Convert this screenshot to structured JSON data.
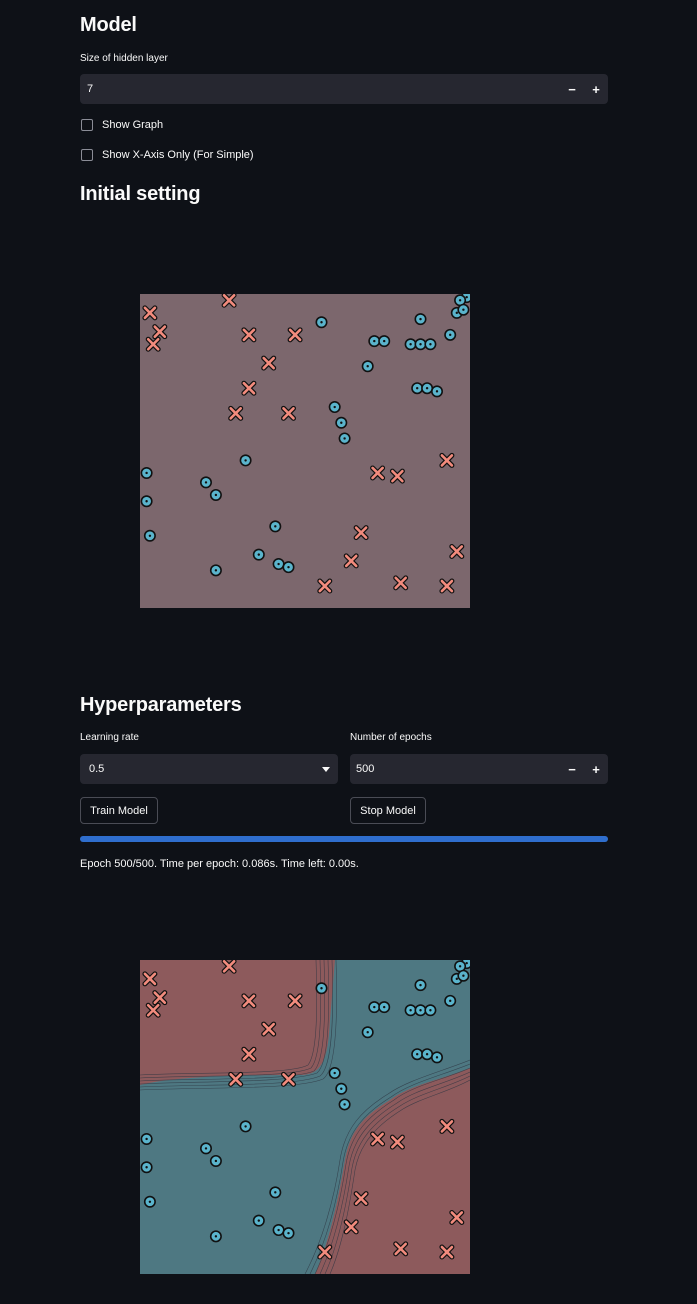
{
  "model": {
    "heading": "Model",
    "hidden_label": "Size of hidden layer",
    "hidden_value": "7",
    "minus": "−",
    "plus": "+",
    "show_graph": "Show Graph",
    "show_x_axis": "Show X-Axis Only (For Simple)"
  },
  "initial": {
    "heading": "Initial setting"
  },
  "hyper": {
    "heading": "Hyperparameters",
    "lr_label": "Learning rate",
    "lr_value": "0.5",
    "epochs_label": "Number of epochs",
    "epochs_value": "500",
    "train_button": "Train Model",
    "stop_button": "Stop Model",
    "progress": 1.0,
    "status": "Epoch 500/500. Time per epoch: 0.086s. Time left: 0.00s."
  },
  "colors": {
    "class_x": "#f28b7d",
    "class_o": "#5ab4cc",
    "region_x": "#8d5a5c",
    "region_o": "#4e7882",
    "initial_bg": "#7c676d"
  },
  "chart_data": [
    {
      "type": "scatter",
      "xlim": [
        0,
        1
      ],
      "ylim": [
        0,
        1
      ],
      "series": [
        {
          "marker": "x",
          "points": [
            [
              0.03,
              0.94
            ],
            [
              0.06,
              0.88
            ],
            [
              0.04,
              0.84
            ],
            [
              0.27,
              0.98
            ],
            [
              0.33,
              0.87
            ],
            [
              0.47,
              0.87
            ],
            [
              0.39,
              0.78
            ],
            [
              0.33,
              0.7
            ],
            [
              0.29,
              0.62
            ],
            [
              0.45,
              0.62
            ],
            [
              0.78,
              0.42
            ],
            [
              0.72,
              0.43
            ],
            [
              0.93,
              0.47
            ],
            [
              0.67,
              0.24
            ],
            [
              0.96,
              0.18
            ],
            [
              0.64,
              0.15
            ],
            [
              0.56,
              0.07
            ],
            [
              0.79,
              0.08
            ],
            [
              0.93,
              0.07
            ]
          ]
        },
        {
          "marker": "o",
          "points": [
            [
              0.55,
              0.91
            ],
            [
              0.71,
              0.85
            ],
            [
              0.74,
              0.85
            ],
            [
              0.82,
              0.84
            ],
            [
              0.85,
              0.84
            ],
            [
              0.88,
              0.84
            ],
            [
              0.85,
              0.92
            ],
            [
              0.96,
              0.94
            ],
            [
              0.99,
              0.99
            ],
            [
              0.97,
              0.98
            ],
            [
              0.98,
              0.95
            ],
            [
              0.94,
              0.87
            ],
            [
              0.69,
              0.77
            ],
            [
              0.84,
              0.7
            ],
            [
              0.87,
              0.7
            ],
            [
              0.9,
              0.69
            ],
            [
              0.59,
              0.64
            ],
            [
              0.61,
              0.59
            ],
            [
              0.62,
              0.54
            ],
            [
              0.32,
              0.47
            ],
            [
              0.02,
              0.43
            ],
            [
              0.2,
              0.4
            ],
            [
              0.23,
              0.36
            ],
            [
              0.02,
              0.34
            ],
            [
              0.41,
              0.26
            ],
            [
              0.03,
              0.23
            ],
            [
              0.36,
              0.17
            ],
            [
              0.42,
              0.14
            ],
            [
              0.45,
              0.13
            ],
            [
              0.23,
              0.12
            ]
          ]
        }
      ]
    },
    {
      "type": "scatter",
      "xlim": [
        0,
        1
      ],
      "ylim": [
        0,
        1
      ],
      "series": [
        {
          "marker": "x",
          "points": [
            [
              0.03,
              0.94
            ],
            [
              0.06,
              0.88
            ],
            [
              0.04,
              0.84
            ],
            [
              0.27,
              0.98
            ],
            [
              0.33,
              0.87
            ],
            [
              0.47,
              0.87
            ],
            [
              0.39,
              0.78
            ],
            [
              0.33,
              0.7
            ],
            [
              0.29,
              0.62
            ],
            [
              0.45,
              0.62
            ],
            [
              0.78,
              0.42
            ],
            [
              0.72,
              0.43
            ],
            [
              0.93,
              0.47
            ],
            [
              0.67,
              0.24
            ],
            [
              0.96,
              0.18
            ],
            [
              0.64,
              0.15
            ],
            [
              0.56,
              0.07
            ],
            [
              0.79,
              0.08
            ],
            [
              0.93,
              0.07
            ]
          ]
        },
        {
          "marker": "o",
          "points": [
            [
              0.55,
              0.91
            ],
            [
              0.71,
              0.85
            ],
            [
              0.74,
              0.85
            ],
            [
              0.82,
              0.84
            ],
            [
              0.85,
              0.84
            ],
            [
              0.88,
              0.84
            ],
            [
              0.85,
              0.92
            ],
            [
              0.96,
              0.94
            ],
            [
              0.99,
              0.99
            ],
            [
              0.97,
              0.98
            ],
            [
              0.98,
              0.95
            ],
            [
              0.94,
              0.87
            ],
            [
              0.69,
              0.77
            ],
            [
              0.84,
              0.7
            ],
            [
              0.87,
              0.7
            ],
            [
              0.9,
              0.69
            ],
            [
              0.59,
              0.64
            ],
            [
              0.61,
              0.59
            ],
            [
              0.62,
              0.54
            ],
            [
              0.32,
              0.47
            ],
            [
              0.02,
              0.43
            ],
            [
              0.2,
              0.4
            ],
            [
              0.23,
              0.36
            ],
            [
              0.02,
              0.34
            ],
            [
              0.41,
              0.26
            ],
            [
              0.03,
              0.23
            ],
            [
              0.36,
              0.17
            ],
            [
              0.42,
              0.14
            ],
            [
              0.45,
              0.13
            ],
            [
              0.23,
              0.12
            ]
          ]
        }
      ]
    }
  ]
}
